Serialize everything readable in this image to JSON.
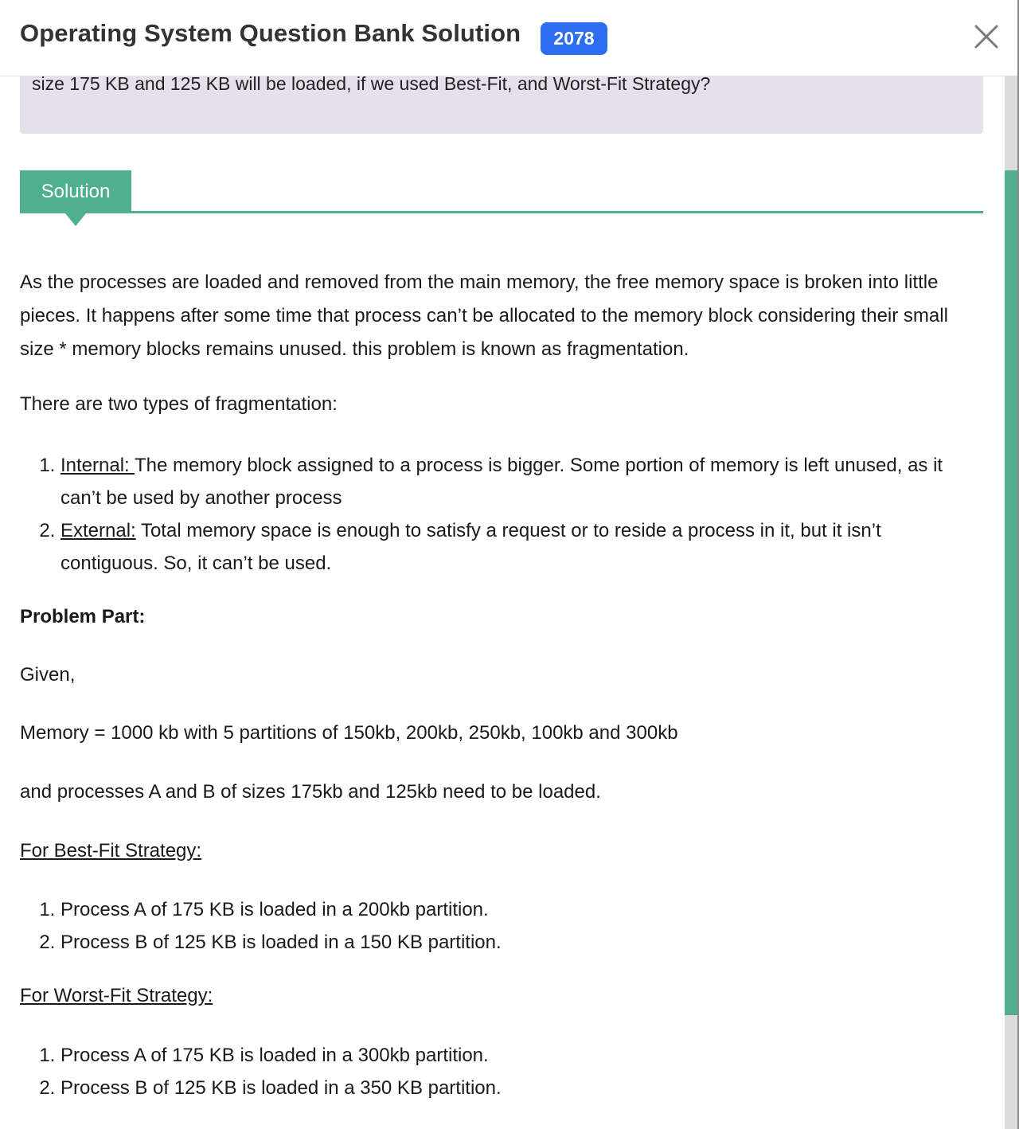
{
  "header": {
    "title": "Operating System Question Bank Solution",
    "year_badge": "2078"
  },
  "question": {
    "text": "size 175 KB and 125 KB will be loaded, if we used Best-Fit, and Worst-Fit Strategy?"
  },
  "solution_tab": {
    "label": "Solution"
  },
  "content": {
    "intro": "As the processes are loaded and removed from the main memory, the free memory space is broken into little pieces. It happens after some time that process can’t be allocated to the memory block considering their small size * memory blocks remains unused. this problem is known as fragmentation.",
    "types_heading": "There are two types of fragmentation:",
    "types": [
      {
        "term": "Internal: ",
        "desc": "The memory block assigned to a process is bigger. Some portion of memory is left unused, as it can’t be used by another process"
      },
      {
        "term": "External:",
        "desc": " Total memory space is enough to satisfy a request or to reside a process in it, but it isn’t contiguous. So, it can’t be used."
      }
    ],
    "problem_heading": "Problem Part:",
    "given": "Given,",
    "memory_line": "Memory = 1000 kb with 5 partitions of 150kb, 200kb, 250kb, 100kb and 300kb",
    "processes_line": "and processes A and B of sizes 175kb and 125kb need to be loaded.",
    "best_fit_heading": "For Best-Fit Strategy:",
    "best_fit": [
      "Process A of 175 KB is loaded in a 200kb partition.",
      "Process B of 125 KB is loaded in a 150 KB partition."
    ],
    "worst_fit_heading": "For Worst-Fit Strategy:",
    "worst_fit": [
      "Process A of 175 KB is loaded in a 300kb partition.",
      "Process B of 125 KB is loaded in a 350 KB partition."
    ]
  },
  "icons": {
    "close": "close-icon"
  },
  "colors": {
    "accent": "#4faf8f",
    "badge": "#2d6df0",
    "question_bg": "#e6e0ed"
  }
}
